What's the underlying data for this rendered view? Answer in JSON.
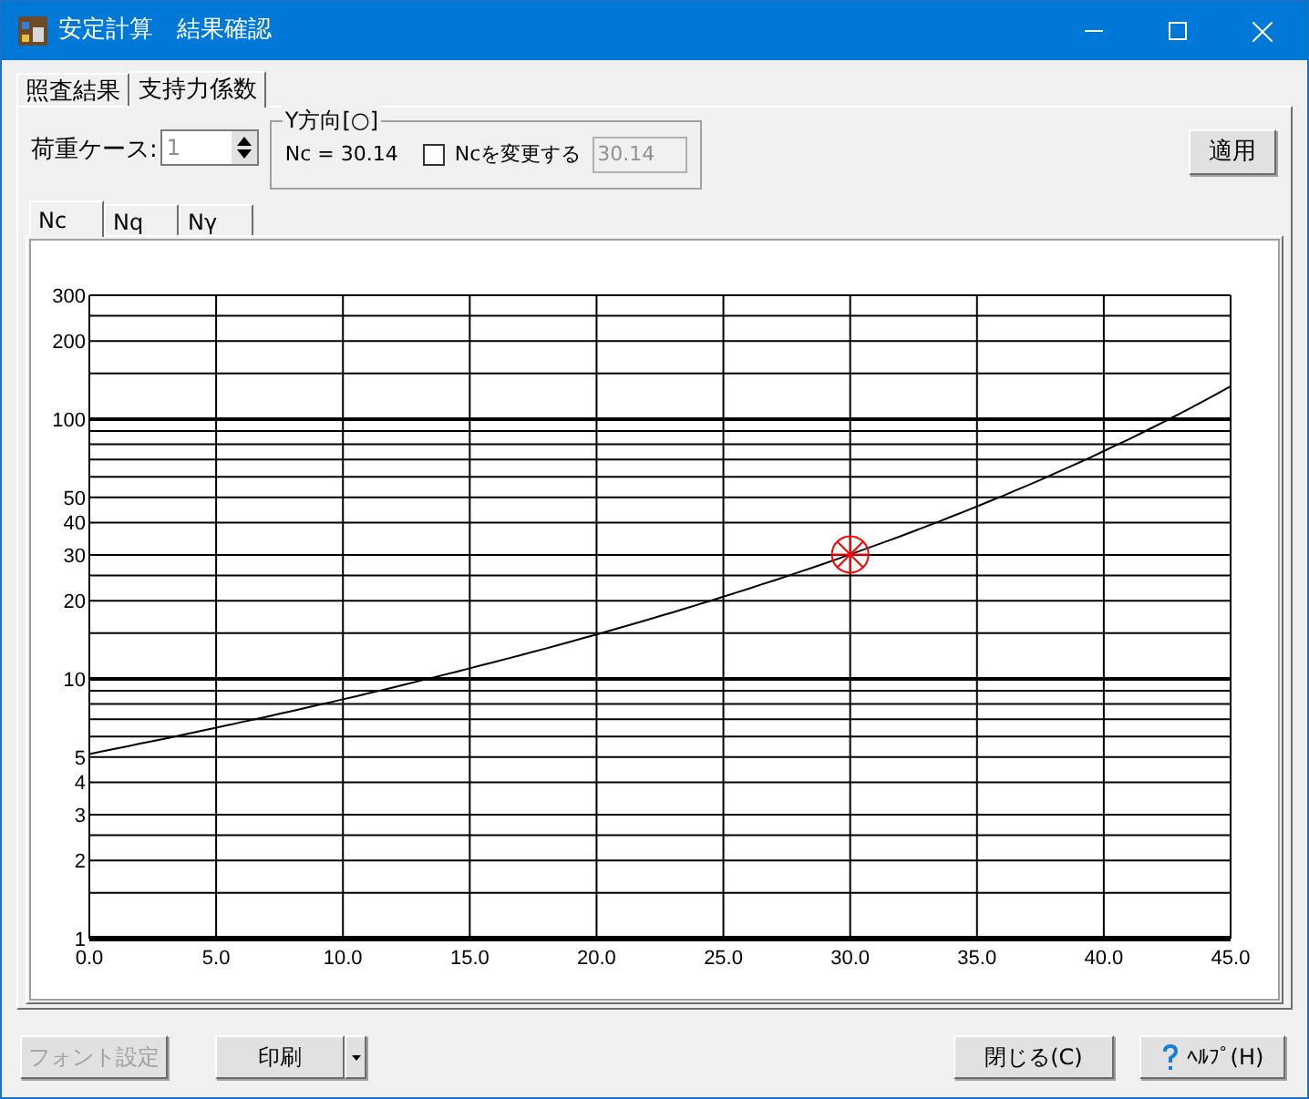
{
  "window": {
    "title": "安定計算　結果確認"
  },
  "tabs": [
    {
      "label": "照査結果",
      "selected": false
    },
    {
      "label": "支持力係数",
      "selected": true
    }
  ],
  "load_case": {
    "label": "荷重ケース:",
    "value": "1"
  },
  "direction_group": {
    "title": "Y方向[○]",
    "reading": "Nc = 30.14",
    "override": {
      "label": "Ncを変更する",
      "checked": false
    },
    "override_value": "30.14"
  },
  "apply_button": "適用",
  "factor_tabs": [
    {
      "label": "Nc",
      "selected": true
    },
    {
      "label": "Nq",
      "selected": false
    },
    {
      "label": "Nγ",
      "selected": false
    }
  ],
  "graph": {
    "y_axis_labels": [
      "300",
      "200",
      "100",
      "50",
      "40",
      "30",
      "20",
      "10",
      "5",
      "4",
      "3",
      "2",
      "1"
    ],
    "x_axis_labels": [
      "0.0",
      "5.0",
      "10.0",
      "15.0",
      "20.0",
      "25.0",
      "30.0",
      "35.0",
      "40.0",
      "45.0"
    ]
  },
  "footer": {
    "font_button": {
      "label": "フォント設定",
      "disabled": true
    },
    "print_button": "印刷",
    "close_button": "閉じる(C)",
    "help_button": "ﾍﾙﾌﾟ(H)"
  }
}
